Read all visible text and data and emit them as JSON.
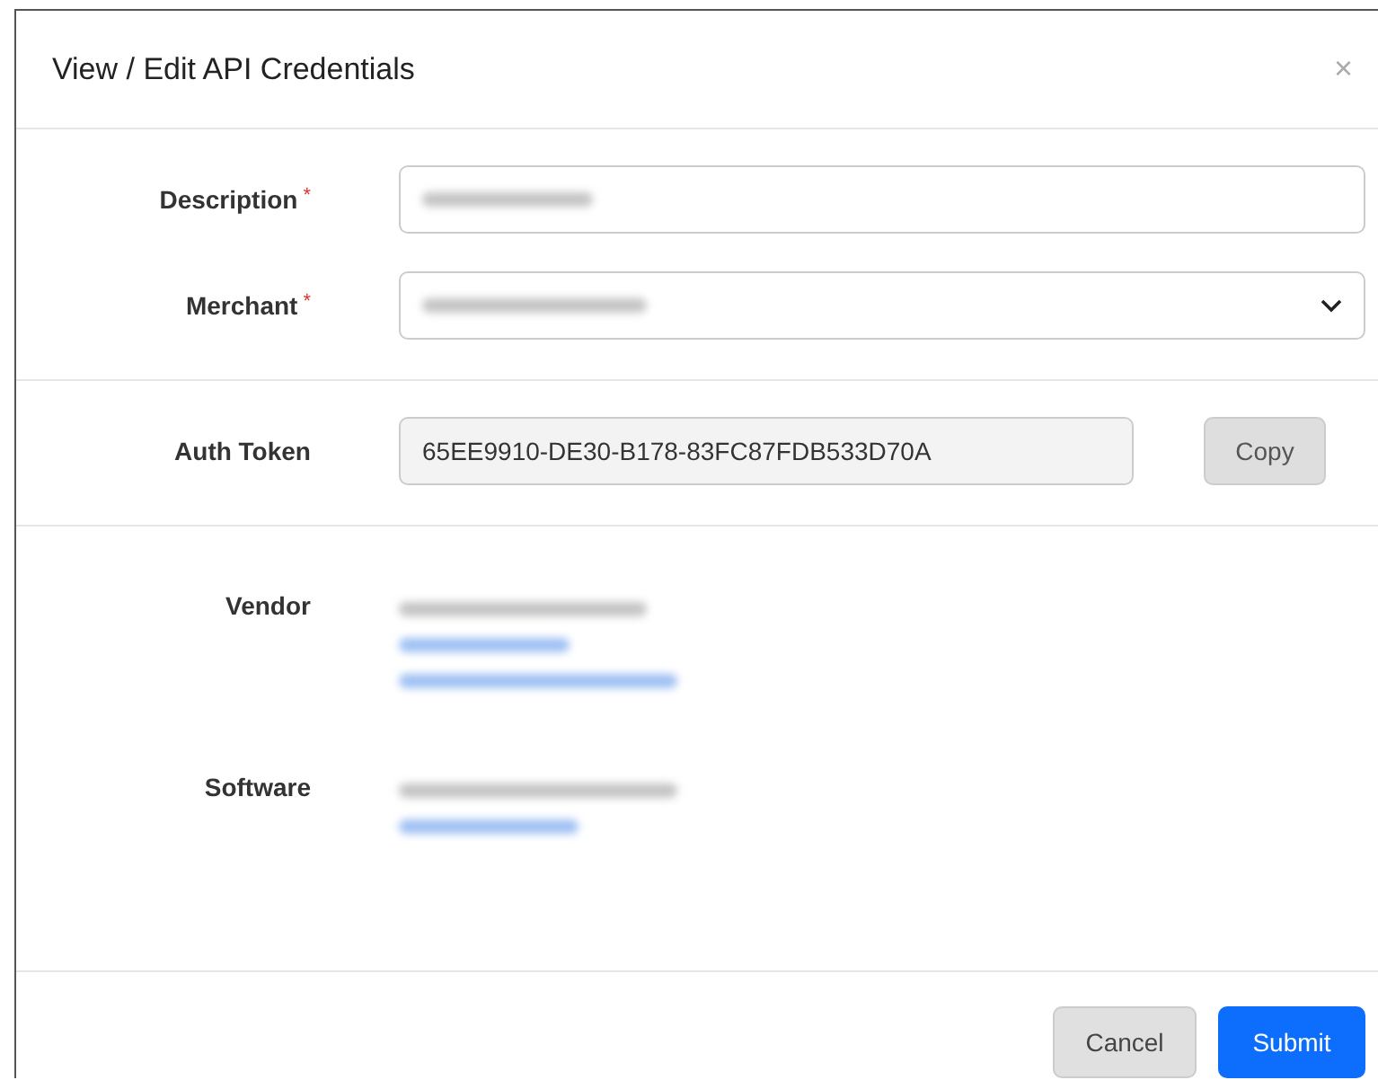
{
  "dialog": {
    "title": "View / Edit API Credentials",
    "close": "×"
  },
  "form": [
    {
      "label": "Description",
      "required_mark": "*",
      "kind": "input",
      "value": {
        "kind": "blurred"
      }
    },
    {
      "label": "Merchant",
      "required_mark": "*",
      "kind": "select",
      "value": {
        "kind": "blurred"
      }
    }
  ],
  "auth": {
    "label": "Auth Token",
    "value": "65EE9910-DE30-B178-83FC87FDB533D70A",
    "readonly": true,
    "button": "Copy"
  },
  "info": [
    {
      "label": "Vendor",
      "lines": [
        {
          "kind": "blurred-text"
        },
        {
          "kind": "blurred-link"
        },
        {
          "kind": "blurred-link"
        }
      ]
    },
    {
      "label": "Software",
      "lines": [
        {
          "kind": "blurred-text"
        },
        {
          "kind": "blurred-link"
        }
      ]
    }
  ],
  "buttons": [
    {
      "label": "Cancel",
      "kind": "secondary"
    },
    {
      "label": "Submit",
      "kind": "primary"
    }
  ]
}
